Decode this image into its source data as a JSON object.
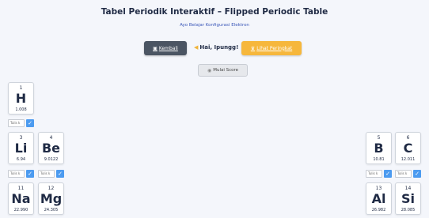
{
  "header": {
    "title": "Tabel Periodik Interaktif – Flipped Periodic Table",
    "subtitle": "Ayo Belajar Konfigurasi Elektron"
  },
  "toolbar": {
    "back_label": "Kembali",
    "back_icon": "back-icon",
    "greeting": "Hai, Ipungg!",
    "greeting_icon": "megaphone-icon",
    "rank_label": "Lihat Peringkat",
    "rank_icon": "trophy-icon",
    "score_label": "Mulai Score",
    "score_icon": "eye-icon"
  },
  "answer_placeholder": "Tulis k",
  "check_symbol": "✓",
  "elements": [
    {
      "number": "1",
      "symbol": "H",
      "mass": "1.008"
    },
    {
      "number": "3",
      "symbol": "Li",
      "mass": "6.94"
    },
    {
      "number": "4",
      "symbol": "Be",
      "mass": "9.0122"
    },
    {
      "number": "5",
      "symbol": "B",
      "mass": "10.81"
    },
    {
      "number": "6",
      "symbol": "C",
      "mass": "12.011"
    },
    {
      "number": "11",
      "symbol": "Na",
      "mass": "22.990"
    },
    {
      "number": "12",
      "symbol": "Mg",
      "mass": "24.305"
    },
    {
      "number": "13",
      "symbol": "Al",
      "mass": "26.982"
    },
    {
      "number": "14",
      "symbol": "Si",
      "mass": "28.085"
    }
  ]
}
